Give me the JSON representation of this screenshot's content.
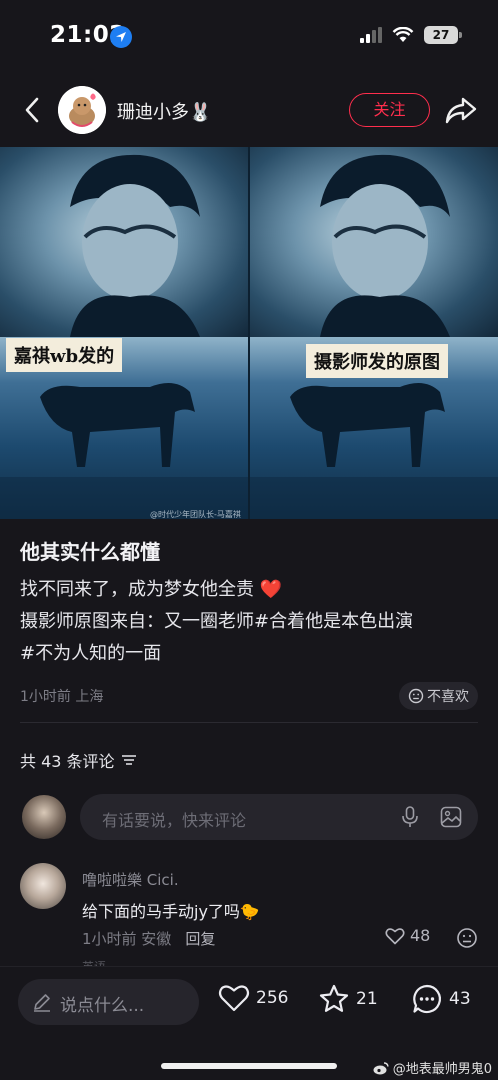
{
  "status_bar": {
    "time": "21:02",
    "battery": "27"
  },
  "nav": {
    "author_name": "珊迪小多🐰",
    "follow_label": "关注"
  },
  "photo": {
    "caption_left": "嘉祺wb发的",
    "caption_right": "摄影师发的原图",
    "watermark": "@时代少年团队长-马嘉祺"
  },
  "post": {
    "title": "他其实什么都懂",
    "body_line1": "找不同来了，成为梦女他全责",
    "body_heart": "❤️",
    "body_line2": "摄影师原图来自：又一圈老师#合着他是本色出演",
    "body_line3": "#不为人知的一面",
    "meta": "1小时前 上海",
    "dislike_label": "不喜欢"
  },
  "comments": {
    "count_label": "共 43 条评论",
    "input_placeholder": "有话要说，快来评论",
    "items": [
      {
        "name": "噜啦啦樂 Cici.",
        "text": "给下面的马手动jy了吗🐤",
        "time_location": "1小时前 安徽",
        "reply_label": "回复",
        "likes": "48"
      }
    ],
    "cut_off_text": "英语"
  },
  "bottom_bar": {
    "say_placeholder": "说点什么...",
    "likes": "256",
    "stars": "21",
    "comments": "43"
  },
  "weibo_watermark": "@地表最帅男鬼0",
  "colors": {
    "accent_red": "#ff2e4d",
    "background": "#17161b"
  }
}
